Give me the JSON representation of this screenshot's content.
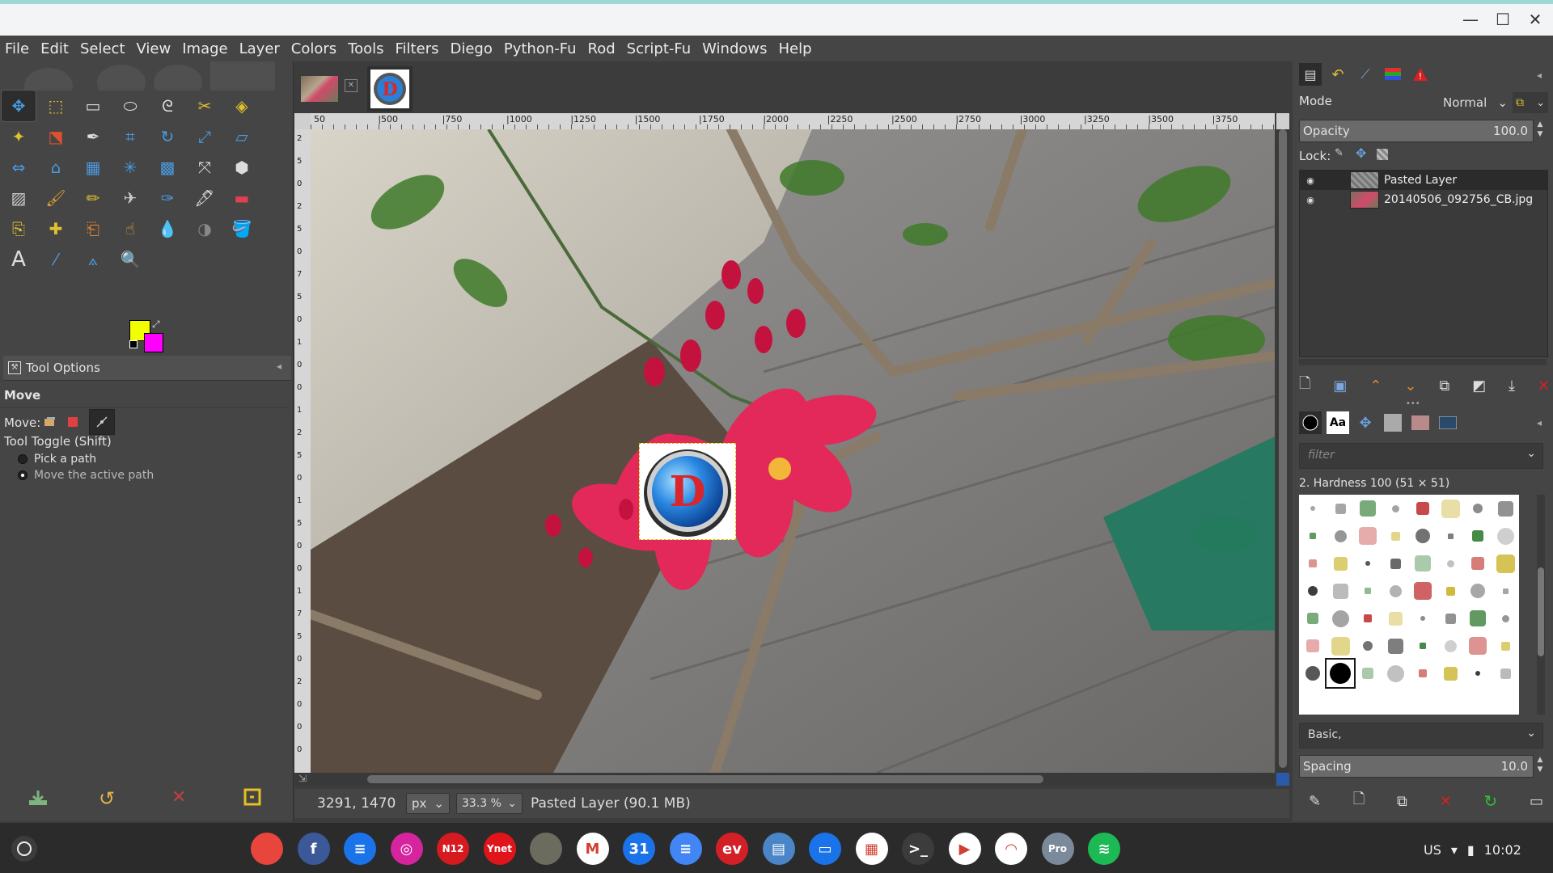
{
  "window": {
    "minimize_glyph": "—",
    "maximize_glyph": "☐",
    "close_glyph": "✕"
  },
  "menubar": [
    "File",
    "Edit",
    "Select",
    "View",
    "Image",
    "Layer",
    "Colors",
    "Tools",
    "Filters",
    "Diego",
    "Python-Fu",
    "Rod",
    "Script-Fu",
    "Windows",
    "Help"
  ],
  "toolbox": {
    "tool_options_tab": "Tool Options",
    "section_title": "Move",
    "move_label": "Move:",
    "tool_toggle_label": "Tool Toggle  (Shift)",
    "radio_options": [
      "Pick a path",
      "Move the active path"
    ],
    "selected_radio_index": 1,
    "fg_color": "#f2ff00",
    "bg_color": "#ff00ff"
  },
  "tools": [
    "move-tool",
    "align-tool",
    "rect-select-tool",
    "ellipse-select-tool",
    "free-select-tool",
    "scissors-tool",
    "foreground-select-tool",
    "fuzzy-select-tool",
    "select-by-color-tool",
    "paths-tool",
    "crop-tool",
    "rotate-tool",
    "scale-tool",
    "shear-tool",
    "flip-tool",
    "perspective-tool",
    "unified-transform-tool",
    "handle-transform-tool",
    "cage-tool",
    "warp-tool",
    "3d-transform-tool",
    "gradient-tool",
    "paintbrush-tool",
    "pencil-tool",
    "airbrush-tool",
    "ink-tool",
    "mypaint-brush-tool",
    "eraser-tool",
    "clone-tool",
    "heal-tool",
    "perspective-clone-tool",
    "smudge-tool",
    "blur-tool",
    "dodge-burn-tool",
    "bucket-fill-tool",
    "text-tool",
    "color-picker-tool",
    "measure-tool",
    "zoom-tool"
  ],
  "ruler_marks": [
    "50",
    "|500",
    "|750",
    "|1000",
    "|1250",
    "|1500",
    "|1750",
    "|2000",
    "|2250",
    "|2500",
    "|2750",
    "|3000",
    "|3250",
    "|3500",
    "|3750"
  ],
  "left_ruler_marks": [
    "2",
    "5",
    "0",
    "2",
    "5",
    "0",
    "7",
    "5",
    "0",
    "1",
    "0",
    "0",
    "1",
    "2",
    "5",
    "0",
    "1",
    "5",
    "0",
    "0",
    "1",
    "7",
    "5",
    "0",
    "2",
    "0",
    "0",
    "0"
  ],
  "statusbar": {
    "coords": "3291, 1470",
    "unit": "px",
    "zoom": "33.3 %",
    "message": "Pasted Layer (90.1 MB)"
  },
  "pasted_logo_letter": "D",
  "layers_panel": {
    "mode_label": "Mode",
    "mode_value": "Normal",
    "opacity_label": "Opacity",
    "opacity_value": "100.0",
    "lock_label": "Lock:",
    "layers": [
      {
        "name": "Pasted Layer",
        "visible": true
      },
      {
        "name": "20140506_092756_CB.jpg",
        "visible": true
      }
    ]
  },
  "brushes_panel": {
    "filter_placeholder": "filter",
    "selected_brush": "2. Hardness 100 (51 × 51)",
    "preset": "Basic,",
    "spacing_label": "Spacing",
    "spacing_value": "10.0"
  },
  "shelf": {
    "apps": [
      {
        "name": "chrome",
        "label": "",
        "color": "#e8453c"
      },
      {
        "name": "facebook",
        "label": "f",
        "color": "#3b5998"
      },
      {
        "name": "messages",
        "label": "≡",
        "color": "#1a73e8"
      },
      {
        "name": "instagram",
        "label": "◎",
        "color": "#d6249f"
      },
      {
        "name": "n12",
        "label": "N12",
        "color": "#d71920"
      },
      {
        "name": "ynet",
        "label": "Ynet",
        "color": "#e0151b"
      },
      {
        "name": "gimp",
        "label": "",
        "color": "#6b6b5e"
      },
      {
        "name": "gmail",
        "label": "M",
        "color": "#ffffff"
      },
      {
        "name": "calendar",
        "label": "31",
        "color": "#1a73e8"
      },
      {
        "name": "docs",
        "label": "≡",
        "color": "#4285f4"
      },
      {
        "name": "ev",
        "label": "ev",
        "color": "#d32027"
      },
      {
        "name": "cabinet",
        "label": "▤",
        "color": "#4a86c7"
      },
      {
        "name": "files",
        "label": "▭",
        "color": "#1a73e8"
      },
      {
        "name": "grid-app",
        "label": "▦",
        "color": "#ffffff"
      },
      {
        "name": "terminal",
        "label": ">_",
        "color": "#3c3c3c"
      },
      {
        "name": "play-store",
        "label": "▶",
        "color": "#ffffff"
      },
      {
        "name": "chrome-remote",
        "label": "◠",
        "color": "#ffffff"
      },
      {
        "name": "pro",
        "label": "Pro",
        "color": "#7a8a9a"
      },
      {
        "name": "spotify",
        "label": "≋",
        "color": "#1db954"
      }
    ],
    "locale": "US",
    "time": "10:02"
  }
}
